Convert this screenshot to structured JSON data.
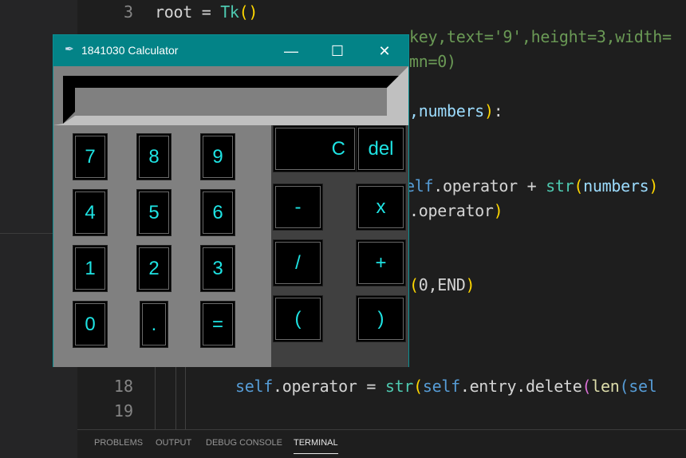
{
  "editor": {
    "line_numbers": [
      "3",
      "18",
      "19"
    ],
    "line3": {
      "a": "root = ",
      "b": "Tk",
      "c": "(",
      "d": ")"
    },
    "line4": "key,text='9',height=3,width=",
    "line5": "mn=0)",
    "line7": {
      "a": ",numbers",
      "b": ")",
      "c": ":"
    },
    "line9": {
      "a": "elf",
      "b": ".operator + ",
      "c": "str",
      "d": "(",
      "e": "numbers",
      "f": ")"
    },
    "line10": {
      "a": ".operator",
      "b": ")"
    },
    "line13": {
      "a": "(",
      "b": "0,END",
      "c": ")"
    },
    "line18": {
      "a": "self",
      "b": ".operator = ",
      "c": "str",
      "d": "(",
      "e": "self",
      "f": ".entry.delete",
      "g": "(",
      "h": "len",
      "i": "(",
      "j": "sel"
    }
  },
  "panel": {
    "tabs": [
      "PROBLEMS",
      "OUTPUT",
      "DEBUG CONSOLE",
      "TERMINAL"
    ],
    "active": "TERMINAL"
  },
  "calculator": {
    "title": "1841030 Calculator",
    "controls": {
      "minimize": "—",
      "maximize": "☐",
      "close": "✕"
    },
    "entry_value": "",
    "buttons": {
      "b7": "7",
      "b8": "8",
      "b9": "9",
      "b4": "4",
      "b5": "5",
      "b6": "6",
      "b1": "1",
      "b2": "2",
      "b3": "3",
      "b0": "0",
      "dot": ".",
      "eq": "=",
      "clear": "C",
      "del": "del",
      "minus": "-",
      "mul": "x",
      "div": "/",
      "plus": "+",
      "lp": "(",
      "rp": ")"
    },
    "colors": {
      "titlebar": "#038387",
      "button_text": "#1ee3e3"
    }
  }
}
